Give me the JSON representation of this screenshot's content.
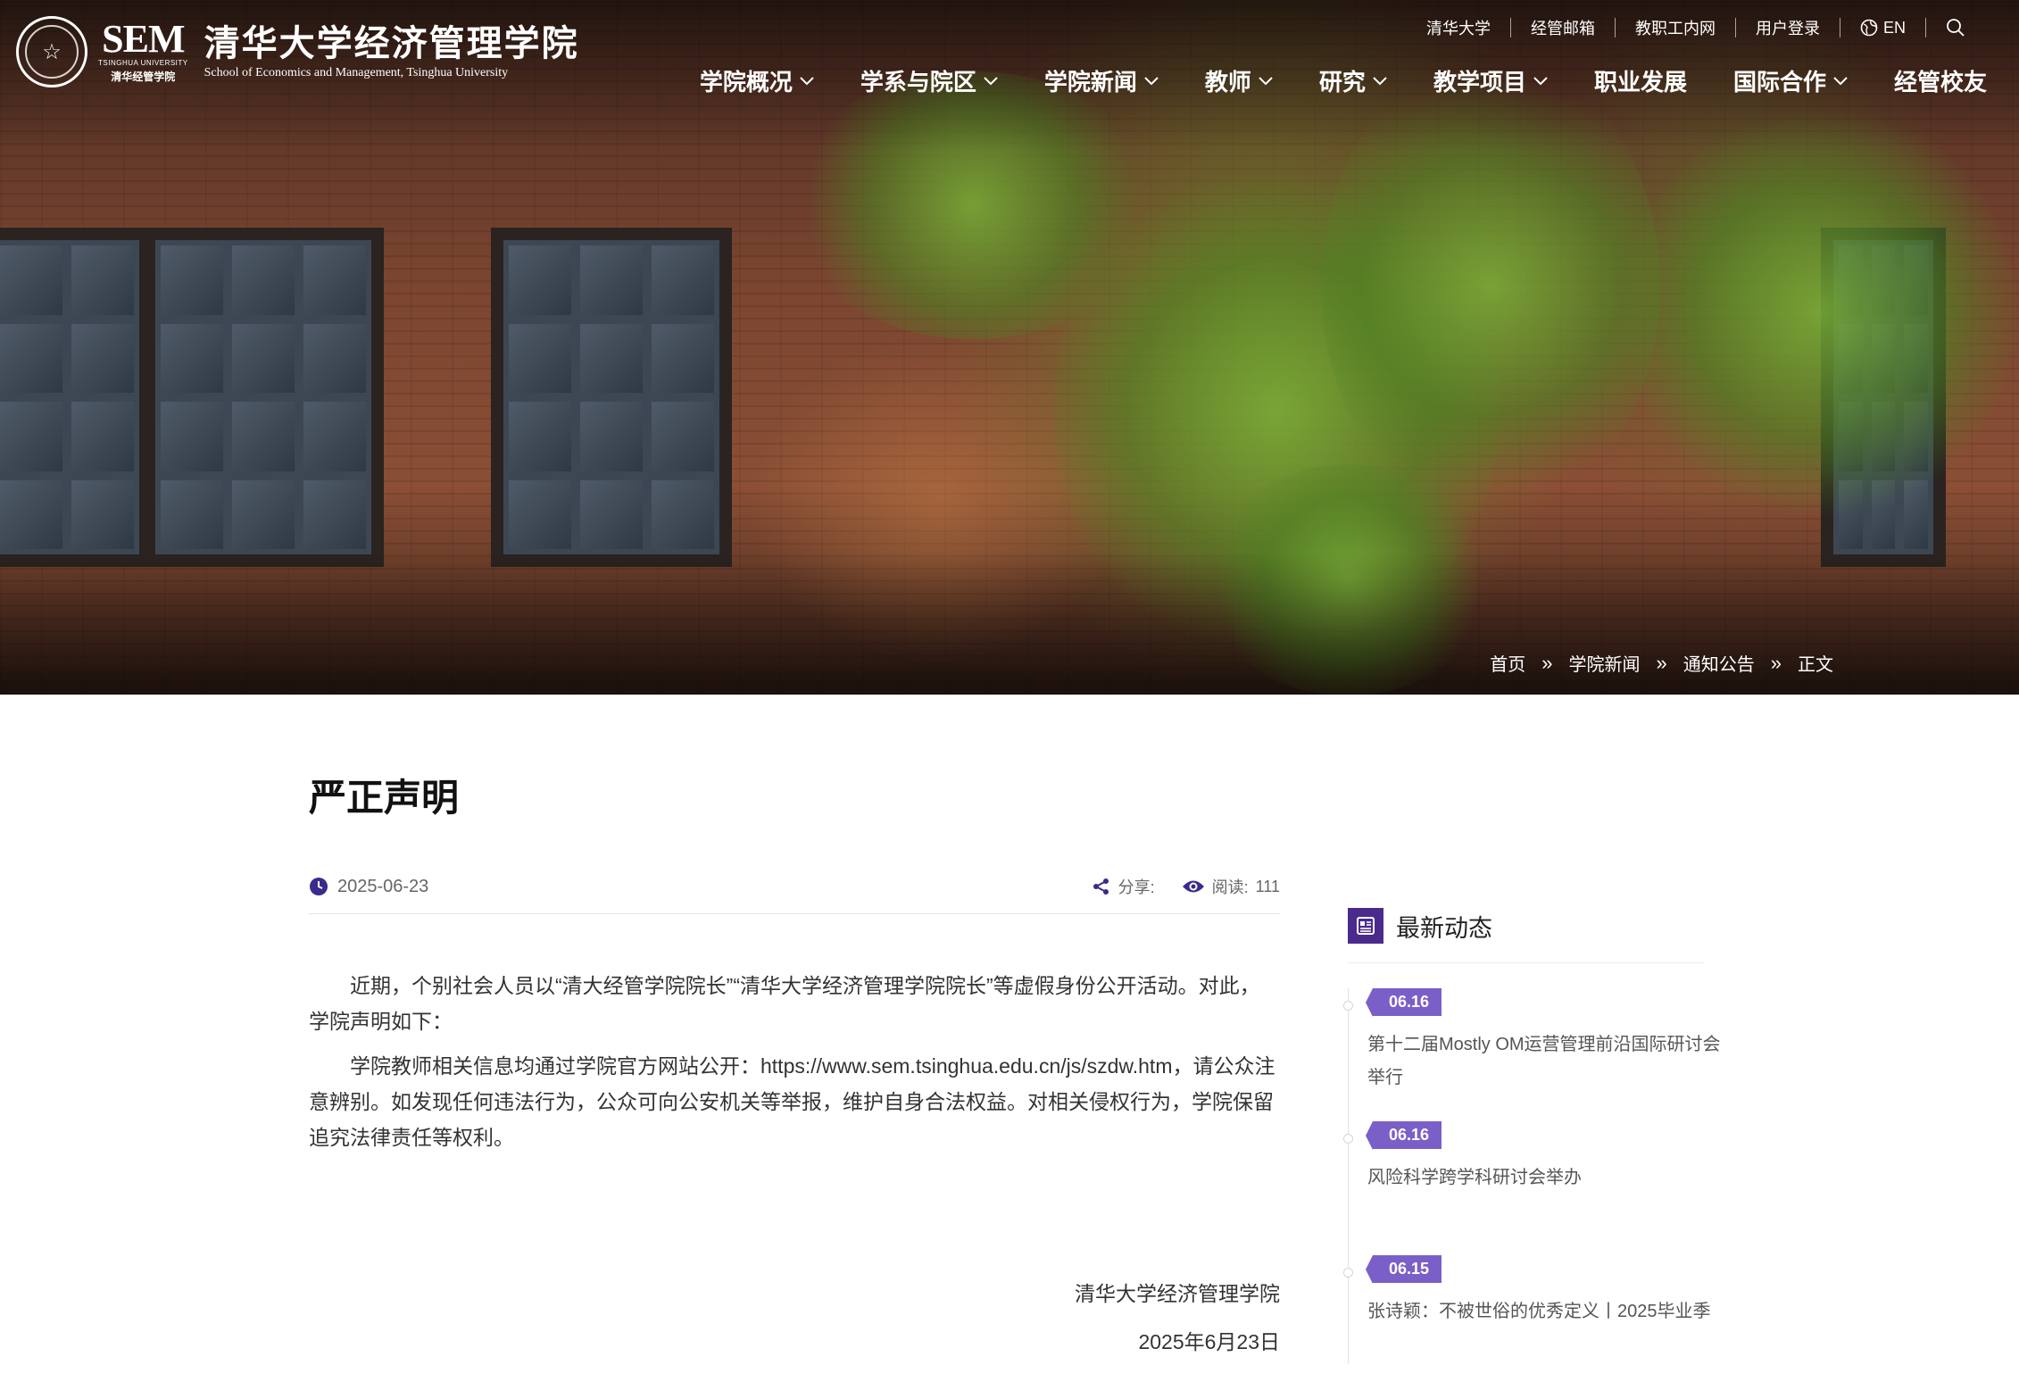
{
  "header": {
    "logo_sem": "SEM",
    "logo_sem_sub": "TSINGHUA UNIVERSITY",
    "logo_sem_cn": "清华经管学院",
    "logo_cn": "清华大学经济管理学院",
    "logo_en": "School of Economics and Management, Tsinghua University",
    "utility": [
      "清华大学",
      "经管邮箱",
      "教职工内网",
      "用户登录"
    ],
    "lang": "EN",
    "nav": [
      {
        "label": "学院概况",
        "dropdown": true
      },
      {
        "label": "学系与院区",
        "dropdown": true
      },
      {
        "label": "学院新闻",
        "dropdown": true
      },
      {
        "label": "教师",
        "dropdown": true
      },
      {
        "label": "研究",
        "dropdown": true
      },
      {
        "label": "教学项目",
        "dropdown": true
      },
      {
        "label": "职业发展",
        "dropdown": false
      },
      {
        "label": "国际合作",
        "dropdown": true
      },
      {
        "label": "经管校友",
        "dropdown": false
      }
    ]
  },
  "breadcrumb": {
    "items": [
      "首页",
      "学院新闻",
      "通知公告",
      "正文"
    ],
    "separator": "»"
  },
  "article": {
    "title": "严正声明",
    "date": "2025-06-23",
    "share_label": "分享:",
    "read_label": "阅读:",
    "read_count": "111",
    "paragraphs": [
      "近期，个别社会人员以“清大经管学院院长”“清华大学经济管理学院院长”等虚假身份公开活动。对此，学院声明如下：",
      "学院教师相关信息均通过学院官方网站公开：https://www.sem.tsinghua.edu.cn/js/szdw.htm，请公众注意辨别。如发现任何违法行为，公众可向公安机关等举报，维护自身合法权益。对相关侵权行为，学院保留追究法律责任等权利。"
    ],
    "signature": "清华大学经济管理学院",
    "signature_date": "2025年6月23日"
  },
  "sidebar": {
    "title": "最新动态",
    "items": [
      {
        "date": "06.16",
        "title": "第十二届Mostly OM运营管理前沿国际研讨会举行"
      },
      {
        "date": "06.16",
        "title": "风险科学跨学科研讨会举办"
      },
      {
        "date": "06.15",
        "title": "张诗颖：不被世俗的优秀定义丨2025毕业季"
      }
    ]
  },
  "colors": {
    "accent": "#4a2a8d",
    "badge": "#7b5fc8"
  }
}
